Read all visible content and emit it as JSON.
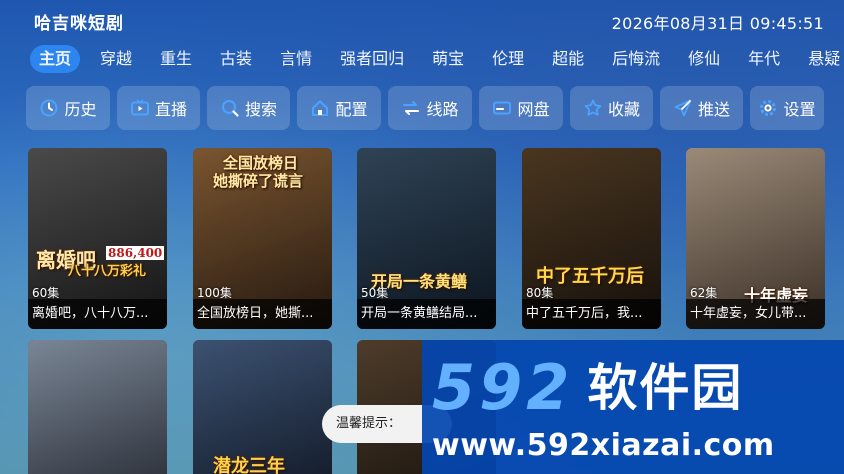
{
  "app": {
    "title": "哈吉咪短剧",
    "datetime": "2026年08月31日 09:45:51"
  },
  "tabs": [
    {
      "label": "主页",
      "active": true
    },
    {
      "label": "穿越"
    },
    {
      "label": "重生"
    },
    {
      "label": "古装"
    },
    {
      "label": "言情"
    },
    {
      "label": "强者回归"
    },
    {
      "label": "萌宝"
    },
    {
      "label": "伦理"
    },
    {
      "label": "超能"
    },
    {
      "label": "后悔流"
    },
    {
      "label": "修仙"
    },
    {
      "label": "年代"
    },
    {
      "label": "悬疑"
    }
  ],
  "toolbar": [
    {
      "label": "历史",
      "icon": "history-icon"
    },
    {
      "label": "直播",
      "icon": "tv-icon"
    },
    {
      "label": "搜索",
      "icon": "search-icon"
    },
    {
      "label": "配置",
      "icon": "home-icon"
    },
    {
      "label": "线路",
      "icon": "switch-icon"
    },
    {
      "label": "网盘",
      "icon": "card-icon"
    },
    {
      "label": "收藏",
      "icon": "star-icon"
    },
    {
      "label": "推送",
      "icon": "send-icon"
    },
    {
      "label": "设置",
      "icon": "gear-icon"
    }
  ],
  "cards": [
    {
      "episodes": "60集",
      "title": "离婚吧，八十八万...",
      "poster_text": "离婚吧",
      "poster_sub": "八十八万彩礼",
      "price_tag": "886,400",
      "colors": [
        "#3a3a3a",
        "#151515"
      ]
    },
    {
      "episodes": "100集",
      "title": "全国放榜日，她撕...",
      "poster_text": "全国放榜日",
      "poster_sub": "她撕碎了谎言",
      "colors": [
        "#6b4a2a",
        "#2a1d12"
      ]
    },
    {
      "episodes": "50集",
      "title": "开局一条黄鳝结局...",
      "poster_text": "开局一条黄鳝",
      "colors": [
        "#2c3b4a",
        "#0d1722"
      ]
    },
    {
      "episodes": "80集",
      "title": "中了五千万后，我...",
      "poster_text": "中了五千万后",
      "colors": [
        "#3a2a1a",
        "#15100b"
      ]
    },
    {
      "episodes": "62集",
      "title": "十年虚妄，女儿带...",
      "poster_text": "十年虚妄",
      "colors": [
        "#8a7a6a",
        "#3a2e25"
      ]
    },
    {
      "episodes": "",
      "title": "",
      "poster_text": "",
      "colors": [
        "#6e7a8a",
        "#2b2f38"
      ]
    },
    {
      "episodes": "",
      "title": "",
      "poster_text": "潜龙三年",
      "colors": [
        "#3a4d6a",
        "#121a28"
      ]
    },
    {
      "episodes": "",
      "title": "",
      "poster_text": "",
      "colors": [
        "#4a3a2a",
        "#1a140e"
      ]
    }
  ],
  "toast": {
    "text": "温馨提示："
  },
  "watermark": {
    "brand_num": "592",
    "brand_cn": "软件园",
    "url": "www.592xiazai.com"
  }
}
